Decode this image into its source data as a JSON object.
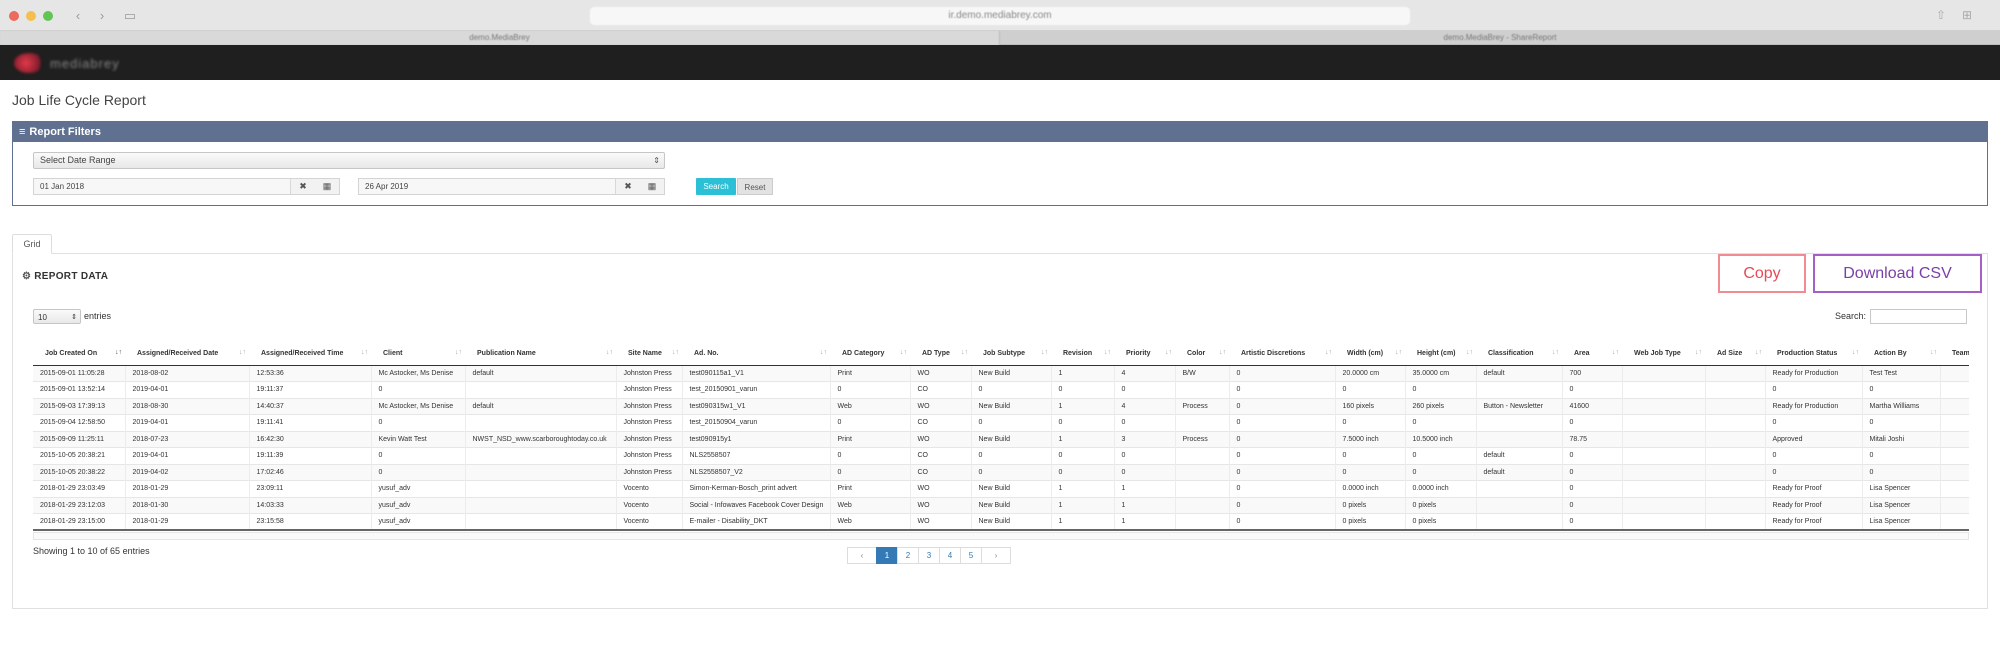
{
  "browser": {
    "url": "ir.demo.mediabrey.com",
    "tabs": [
      "demo.MediaBrey",
      "demo.MediaBrey - ShareReport"
    ]
  },
  "app": {
    "logo_text": "mediabrey"
  },
  "page": {
    "title": "Job Life Cycle Report"
  },
  "filters": {
    "header": "Report Filters",
    "date_range_placeholder": "Select Date Range",
    "start_date": "01 Jan 2018",
    "end_date": "26 Apr 2019",
    "search_label": "Search",
    "reset_label": "Reset"
  },
  "grid_tab": "Grid",
  "report": {
    "title": "REPORT DATA",
    "copy_label": "Copy",
    "csv_label": "Download CSV",
    "page_length": "10",
    "entries_label": "entries",
    "search_label": "Search:"
  },
  "table": {
    "columns": [
      "Job Created On",
      "Assigned/Received Date",
      "Assigned/Received Time",
      "Client",
      "Publication Name",
      "Site Name",
      "Ad. No.",
      "AD Category",
      "AD Type",
      "Job Subtype",
      "Revision",
      "Priority",
      "Color",
      "Artistic Discretions",
      "Width (cm)",
      "Height (cm)",
      "Classification",
      "Area",
      "Web Job Type",
      "Ad Size",
      "Production Status",
      "Action By",
      "Team"
    ],
    "rows": [
      [
        "2015-09-01 11:05:28",
        "2018-08-02",
        "12:53:36",
        "Mc Astocker, Ms Denise",
        "default",
        "Johnston Press",
        "test090115a1_V1",
        "Print",
        "WO",
        "New Build",
        "1",
        "4",
        "B/W",
        "0",
        "20.0000 cm",
        "35.0000 cm",
        "default",
        "700",
        "",
        "",
        "Ready for Production",
        "Test Test",
        ""
      ],
      [
        "2015-09-01 13:52:14",
        "2019-04-01",
        "19:11:37",
        "0",
        "",
        "Johnston Press",
        "test_20150901_varun",
        "0",
        "CO",
        "0",
        "0",
        "0",
        "",
        "0",
        "0",
        "0",
        "",
        "0",
        "",
        "",
        "0",
        "0",
        ""
      ],
      [
        "2015-09-03 17:39:13",
        "2018-08-30",
        "14:40:37",
        "Mc Astocker, Ms Denise",
        "default",
        "Johnston Press",
        "test090315w1_V1",
        "Web",
        "WO",
        "New Build",
        "1",
        "4",
        "Process",
        "0",
        "160 pixels",
        "260 pixels",
        "Button - Newsletter",
        "41600",
        "",
        "",
        "Ready for Production",
        "Martha Williams",
        ""
      ],
      [
        "2015-09-04 12:58:50",
        "2019-04-01",
        "19:11:41",
        "0",
        "",
        "Johnston Press",
        "test_20150904_varun",
        "0",
        "CO",
        "0",
        "0",
        "0",
        "",
        "0",
        "0",
        "0",
        "",
        "0",
        "",
        "",
        "0",
        "0",
        ""
      ],
      [
        "2015-09-09 11:25:11",
        "2018-07-23",
        "16:42:30",
        "Kevin Watt Test",
        "NWST_NSD_www.scarboroughtoday.co.uk",
        "Johnston Press",
        "test090915y1",
        "Print",
        "WO",
        "New Build",
        "1",
        "3",
        "Process",
        "0",
        "7.5000 inch",
        "10.5000 inch",
        "",
        "78.75",
        "",
        "",
        "Approved",
        "Mitali Joshi",
        ""
      ],
      [
        "2015-10-05 20:38:21",
        "2019-04-01",
        "19:11:39",
        "0",
        "",
        "Johnston Press",
        "NLS2558507",
        "0",
        "CO",
        "0",
        "0",
        "0",
        "",
        "0",
        "0",
        "0",
        "default",
        "0",
        "",
        "",
        "0",
        "0",
        ""
      ],
      [
        "2015-10-05 20:38:22",
        "2019-04-02",
        "17:02:46",
        "0",
        "",
        "Johnston Press",
        "NLS2558507_V2",
        "0",
        "CO",
        "0",
        "0",
        "0",
        "",
        "0",
        "0",
        "0",
        "default",
        "0",
        "",
        "",
        "0",
        "0",
        ""
      ],
      [
        "2018-01-29 23:03:49",
        "2018-01-29",
        "23:09:11",
        "yusuf_adv",
        "",
        "Vocento",
        "Simon-Kerman-Bosch_print advert",
        "Print",
        "WO",
        "New Build",
        "1",
        "1",
        "",
        "0",
        "0.0000 inch",
        "0.0000 inch",
        "",
        "0",
        "",
        "",
        "Ready for Proof",
        "Lisa Spencer",
        ""
      ],
      [
        "2018-01-29 23:12:03",
        "2018-01-30",
        "14:03:33",
        "yusuf_adv",
        "",
        "Vocento",
        "Social - Infowaves Facebook Cover Design",
        "Web",
        "WO",
        "New Build",
        "1",
        "1",
        "",
        "0",
        "0 pixels",
        "0 pixels",
        "",
        "0",
        "",
        "",
        "Ready for Proof",
        "Lisa Spencer",
        ""
      ],
      [
        "2018-01-29 23:15:00",
        "2018-01-29",
        "23:15:58",
        "yusuf_adv",
        "",
        "Vocento",
        "E-mailer - Disability_DKT",
        "Web",
        "WO",
        "New Build",
        "1",
        "1",
        "",
        "0",
        "0 pixels",
        "0 pixels",
        "",
        "0",
        "",
        "",
        "Ready for Proof",
        "Lisa Spencer",
        ""
      ]
    ]
  },
  "footer": {
    "showing": "Showing 1 to 10 of 65 entries",
    "prev": "‹",
    "next": "›",
    "pages": [
      "1",
      "2",
      "3",
      "4",
      "5"
    ],
    "active_page": "1"
  },
  "colors": {
    "filter_header": "#5f7090",
    "search_button": "#2cc0d6",
    "copy_button": "#e84a56",
    "csv_button": "#7a3fa8",
    "pager_active": "#337ab7"
  }
}
